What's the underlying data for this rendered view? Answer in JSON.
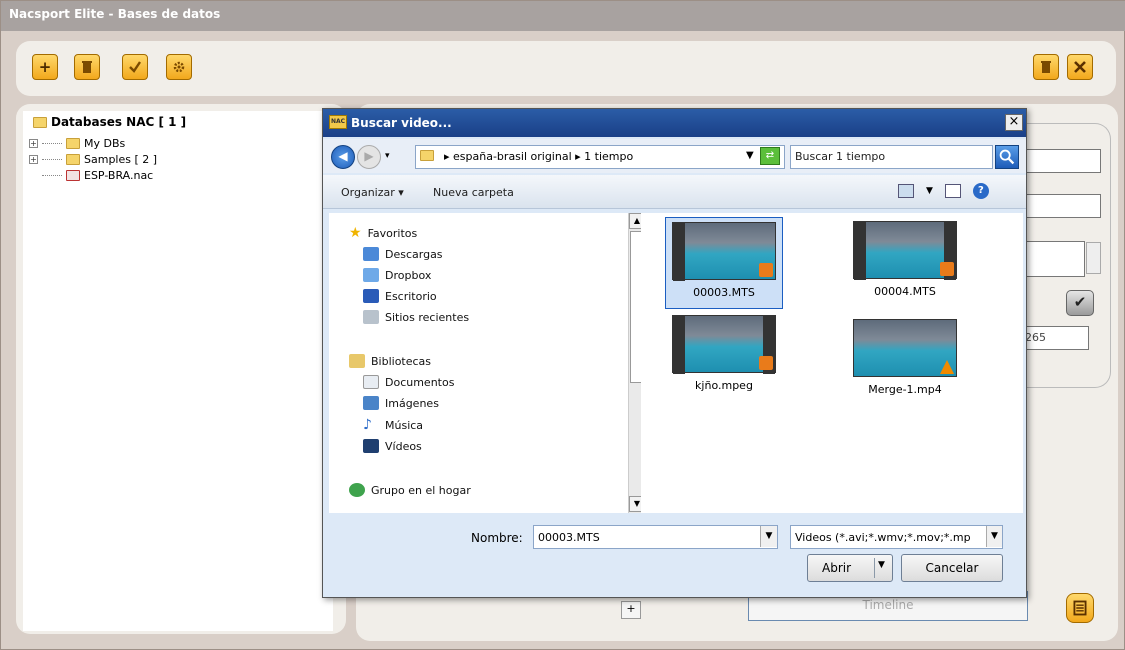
{
  "app": {
    "title": "Nacsport Elite - Bases de datos",
    "tree": {
      "root": "Databases NAC [ 1 ]",
      "items": [
        "My DBs",
        "Samples [ 2 ]",
        "ESP-BRA.nac"
      ]
    },
    "side_value": "265",
    "timeline_label": "Timeline",
    "small_plus": "+"
  },
  "dialog": {
    "title": "Buscar video...",
    "logo_text": "NAC",
    "close": "×",
    "address": {
      "path_folder": "españa-brasil original",
      "path_sub": "1 tiempo",
      "search_placeholder": "Buscar 1 tiempo"
    },
    "commands": {
      "organize": "Organizar ▾",
      "new_folder": "Nueva carpeta"
    },
    "nav": {
      "favorites_header": "Favoritos",
      "favorites": [
        "Descargas",
        "Dropbox",
        "Escritorio",
        "Sitios recientes"
      ],
      "libraries_header": "Bibliotecas",
      "libraries": [
        "Documentos",
        "Imágenes",
        "Música",
        "Vídeos"
      ],
      "homegroup": "Grupo en el hogar"
    },
    "files": [
      {
        "name": "00003.MTS",
        "selected": true
      },
      {
        "name": "00004.MTS",
        "selected": false
      },
      {
        "name": "kjño.mpeg",
        "selected": false
      },
      {
        "name": "Merge-1.mp4",
        "selected": false
      }
    ],
    "filename_label": "Nombre:",
    "filename_value": "00003.MTS",
    "filter": "Videos (*.avi;*.wmv;*.mov;*.mp",
    "open_button": "Abrir",
    "cancel_button": "Cancelar"
  },
  "colors": {
    "accent": "#f2a81c",
    "title_bar": "#1a3f87",
    "panel": "#f1eee9",
    "frame": "#d9cfc8"
  }
}
